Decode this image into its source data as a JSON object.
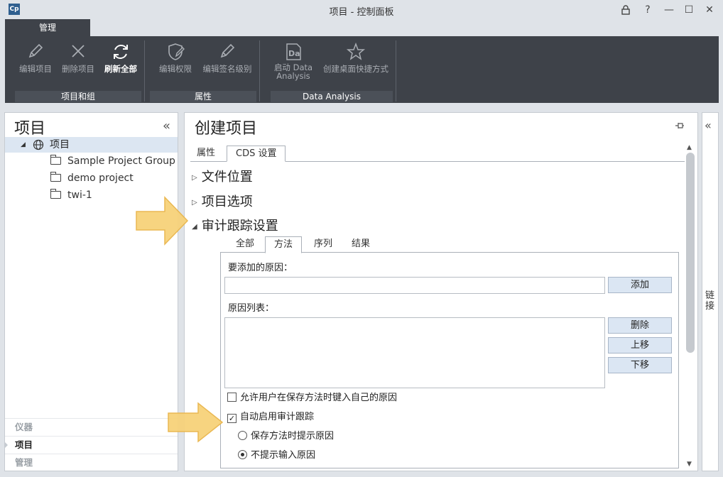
{
  "window": {
    "logo": "Cp",
    "title": "项目 - 控制面板",
    "controls": {
      "lock": "🔒",
      "help": "?",
      "minimize": "—",
      "maximize": "☐",
      "close": "✕"
    }
  },
  "ribbon": {
    "tab": "管理",
    "buttons": [
      {
        "label": "编辑项目",
        "icon": "pencil-icon"
      },
      {
        "label": "删除项目",
        "icon": "close-icon"
      },
      {
        "label": "刷新全部",
        "icon": "refresh-icon"
      },
      {
        "label": "编辑权限",
        "icon": "shield-pencil-icon"
      },
      {
        "label": "编辑签名级别",
        "icon": "pencil-icon"
      },
      {
        "label": "启动 Data Analysis",
        "icon": "data-analysis-icon",
        "icon_text": "Da"
      },
      {
        "label": "创建桌面快捷方式",
        "icon": "star-icon"
      }
    ],
    "groups": [
      "项目和组",
      "属性",
      "Data Analysis"
    ]
  },
  "left_panel": {
    "title": "项目",
    "collapse_icon": "«",
    "tree": {
      "root": "项目",
      "children": [
        "Sample Project Group",
        "demo project",
        "twi-1"
      ]
    },
    "nav": [
      "仪器",
      "项目",
      "管理"
    ]
  },
  "main": {
    "title": "创建项目",
    "tabs": [
      "属性",
      "CDS 设置"
    ],
    "sections": [
      "文件位置",
      "项目选项",
      "审计跟踪设置"
    ],
    "audit": {
      "subtabs": [
        "全部",
        "方法",
        "序列",
        "结果"
      ],
      "reason_to_add_label": "要添加的原因：",
      "reason_to_add_value": "",
      "add_button": "添加",
      "reason_list_label": "原因列表：",
      "delete_button": "删除",
      "move_up_button": "上移",
      "move_down_button": "下移",
      "allow_own_reason": {
        "label": "允许用户在保存方法时键入自己的原因",
        "checked": false
      },
      "auto_enable": {
        "label": "自动启用审计跟踪",
        "checked": true
      },
      "radio_prompt": {
        "label": "保存方法时提示原因",
        "selected": false
      },
      "radio_no_prompt": {
        "label": "不提示输入原因",
        "selected": true
      }
    }
  },
  "right_panel": {
    "collapse_icon": "«",
    "label": "链接"
  },
  "colors": {
    "ribbon_bg": "#3e4249",
    "highlight_arrow": "#f7d27a",
    "button_bg": "#dbe6f3",
    "tree_selected": "#dce6f2"
  }
}
